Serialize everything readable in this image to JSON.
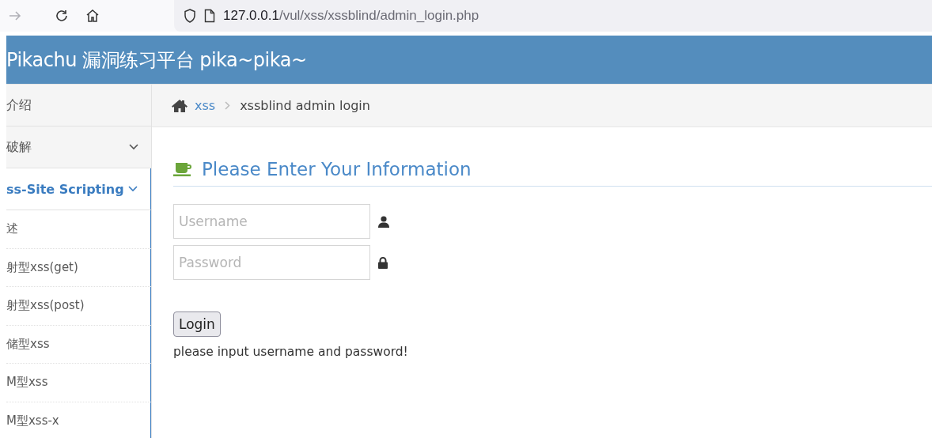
{
  "browser": {
    "url_host": "127.0.0.1",
    "url_path": "/vul/xss/xssblind/admin_login.php"
  },
  "header": {
    "title": "Pikachu 漏洞练习平台 pika~pika~"
  },
  "sidebar": {
    "items": [
      {
        "kind": "top",
        "label": "介绍",
        "expandable": false,
        "selected": false
      },
      {
        "kind": "top",
        "label": "破解",
        "expandable": true,
        "selected": false
      },
      {
        "kind": "top",
        "label": "ss-Site Scripting",
        "expandable": true,
        "selected": true
      },
      {
        "kind": "sub",
        "label": "述",
        "selected": false
      },
      {
        "kind": "sub",
        "label": "射型xss(get)",
        "selected": false
      },
      {
        "kind": "sub",
        "label": "射型xss(post)",
        "selected": false
      },
      {
        "kind": "sub",
        "label": "储型xss",
        "selected": false
      },
      {
        "kind": "sub",
        "label": "M型xss",
        "selected": false
      },
      {
        "kind": "sub",
        "label": "M型xss-x",
        "selected": false
      }
    ]
  },
  "breadcrumb": {
    "link": "xss",
    "current": "xssblind admin login"
  },
  "form": {
    "title": "Please Enter Your Information",
    "username": {
      "placeholder": "Username"
    },
    "password": {
      "placeholder": "Password"
    },
    "button": "Login",
    "message": "please input username and password!"
  }
}
